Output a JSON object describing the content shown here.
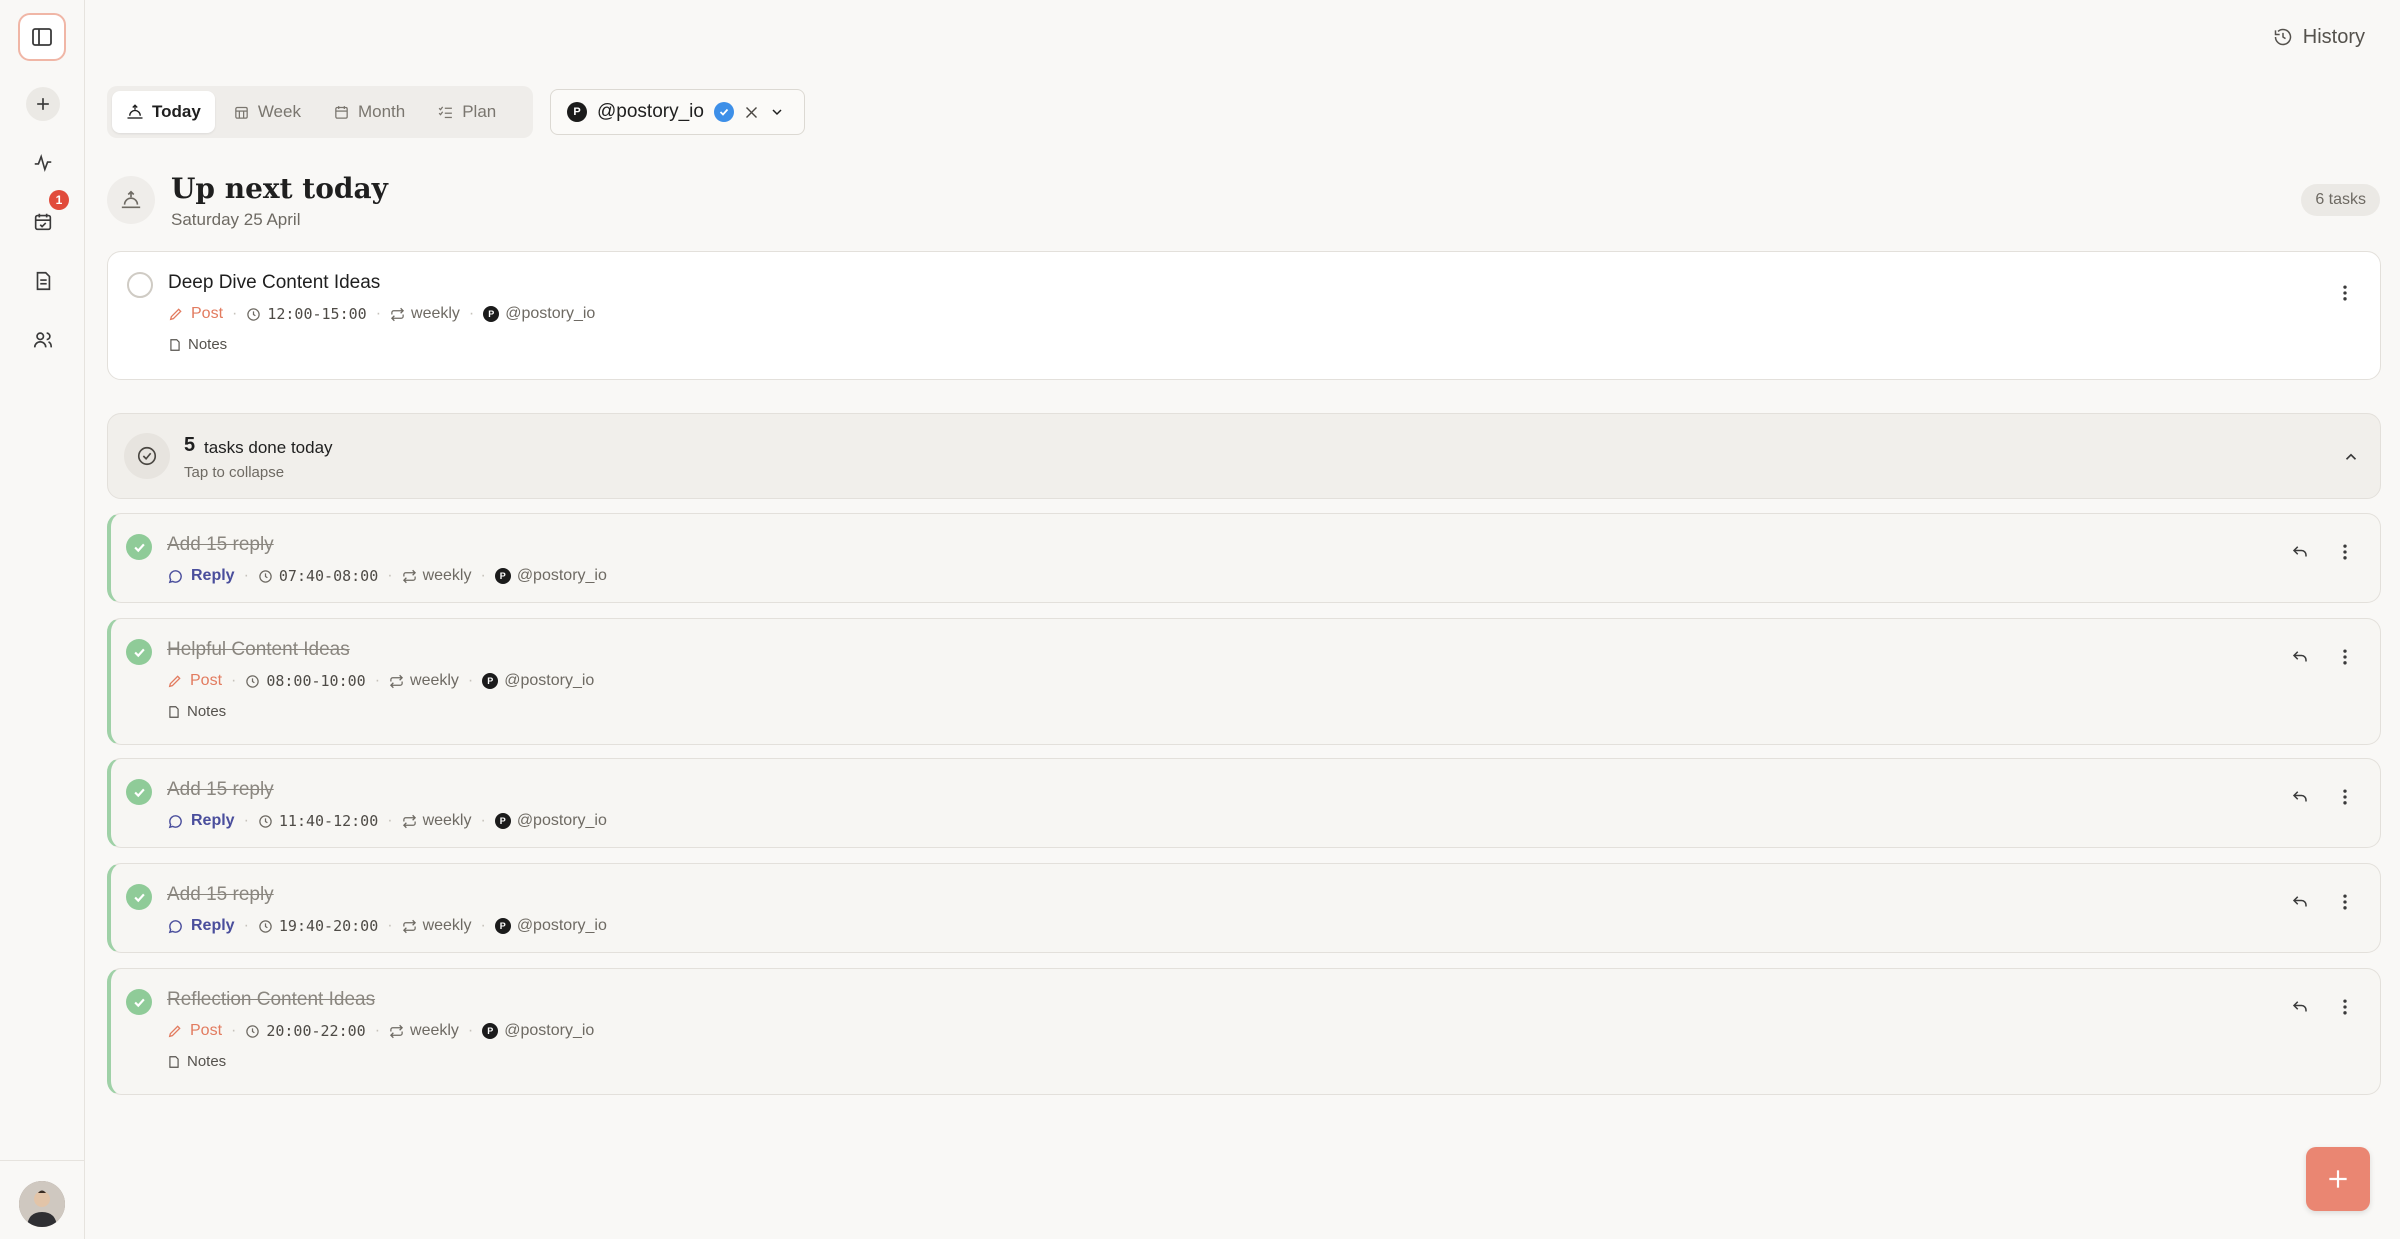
{
  "sidebar": {
    "toggle_icon": "sidebar-toggle-icon",
    "items": [
      {
        "name": "add",
        "icon": "plus-icon"
      },
      {
        "name": "activity",
        "icon": "activity-icon"
      },
      {
        "name": "calendar",
        "icon": "calendar-check-icon",
        "badge": "1"
      },
      {
        "name": "documents",
        "icon": "document-icon"
      },
      {
        "name": "team",
        "icon": "users-icon"
      }
    ]
  },
  "header": {
    "history_label": "History"
  },
  "tabs": [
    {
      "label": "Today",
      "active": true
    },
    {
      "label": "Week"
    },
    {
      "label": "Month"
    },
    {
      "label": "Plan"
    }
  ],
  "account": {
    "handle": "@postory_io",
    "logo_letter": "P"
  },
  "section": {
    "title": "Up next today",
    "date": "Saturday 25 April",
    "count": "6 tasks"
  },
  "upcoming": [
    {
      "title": "Deep Dive Content Ideas",
      "type": "Post",
      "time": "12:00-15:00",
      "repeat": "weekly",
      "account": "@postory_io",
      "notes": "Notes"
    }
  ],
  "done_summary": {
    "count": "5",
    "label": "tasks done today",
    "hint": "Tap to collapse"
  },
  "done_tasks": [
    {
      "title": "Add 15 reply",
      "type": "Reply",
      "time": "07:40-08:00",
      "repeat": "weekly",
      "account": "@postory_io"
    },
    {
      "title": "Helpful Content Ideas",
      "type": "Post",
      "time": "08:00-10:00",
      "repeat": "weekly",
      "account": "@postory_io",
      "notes": "Notes"
    },
    {
      "title": "Add 15 reply",
      "type": "Reply",
      "time": "11:40-12:00",
      "repeat": "weekly",
      "account": "@postory_io"
    },
    {
      "title": "Add 15 reply",
      "type": "Reply",
      "time": "19:40-20:00",
      "repeat": "weekly",
      "account": "@postory_io"
    },
    {
      "title": "Reflection Content Ideas",
      "type": "Post",
      "time": "20:00-22:00",
      "repeat": "weekly",
      "account": "@postory_io",
      "notes": "Notes"
    }
  ],
  "colors": {
    "accent": "#ea8672",
    "done_green": "#8fcb98",
    "reply": "#4a4e9c",
    "post": "#e27b5f"
  }
}
